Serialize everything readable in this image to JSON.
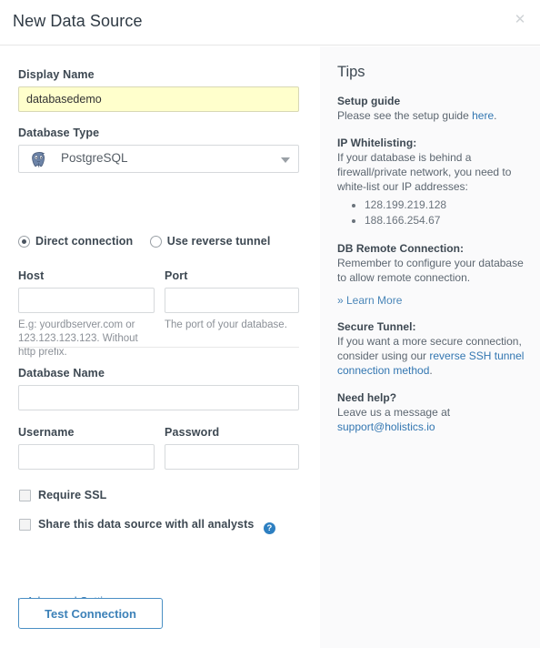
{
  "header": {
    "title": "New Data Source",
    "close_label": "✕"
  },
  "form": {
    "display_name": {
      "label": "Display Name",
      "value": "databasedemo",
      "placeholder": ""
    },
    "database_type": {
      "label": "Database Type",
      "selected": "PostgreSQL",
      "icon": "postgresql-elephant-icon",
      "caret_icon": "chevron-down-icon"
    },
    "connection_mode": {
      "options": [
        {
          "label": "Direct connection",
          "selected": true
        },
        {
          "label": "Use reverse tunnel",
          "selected": false
        }
      ]
    },
    "host": {
      "label": "Host",
      "value": "",
      "help": "E.g: yourdbserver.com or 123.123.123.123. Without http prefix."
    },
    "port": {
      "label": "Port",
      "value": "",
      "help": "The port of your database."
    },
    "database_name": {
      "label": "Database Name",
      "value": ""
    },
    "username": {
      "label": "Username",
      "value": ""
    },
    "password": {
      "label": "Password",
      "value": ""
    },
    "require_ssl": {
      "label": "Require SSL",
      "checked": false
    },
    "share_all_analysts": {
      "label": "Share this data source with all analysts",
      "checked": false,
      "help_icon": "question-mark-icon"
    },
    "advanced_settings": {
      "label": "Advanced Settings"
    },
    "test_connection": {
      "label": "Test Connection"
    }
  },
  "tips": {
    "title": "Tips",
    "setup_guide": {
      "heading": "Setup guide",
      "text_before": "Please see the setup guide ",
      "link": "here",
      "text_after": "."
    },
    "ip_whitelisting": {
      "heading": "IP Whitelisting:",
      "body": "If your database is behind a firewall/private network, you need to white-list our IP addresses:",
      "ips": [
        "128.199.219.128",
        "188.166.254.67"
      ]
    },
    "db_remote_connection": {
      "heading": "DB Remote Connection:",
      "body": "Remember to configure your database to allow remote connection.",
      "learn_more": "» Learn More"
    },
    "secure_tunnel": {
      "heading": "Secure Tunnel:",
      "text_before": "If you want a more secure connection, consider using our ",
      "link": "reverse SSH tunnel connection method",
      "text_after": "."
    },
    "need_help": {
      "heading": "Need help?",
      "text_before": "Leave us a message at ",
      "link": "support@holistics.io"
    }
  },
  "colors": {
    "accent_blue": "#3276b1",
    "autofill_yellow": "#ffffcc",
    "tips_bg": "#fafafb"
  }
}
